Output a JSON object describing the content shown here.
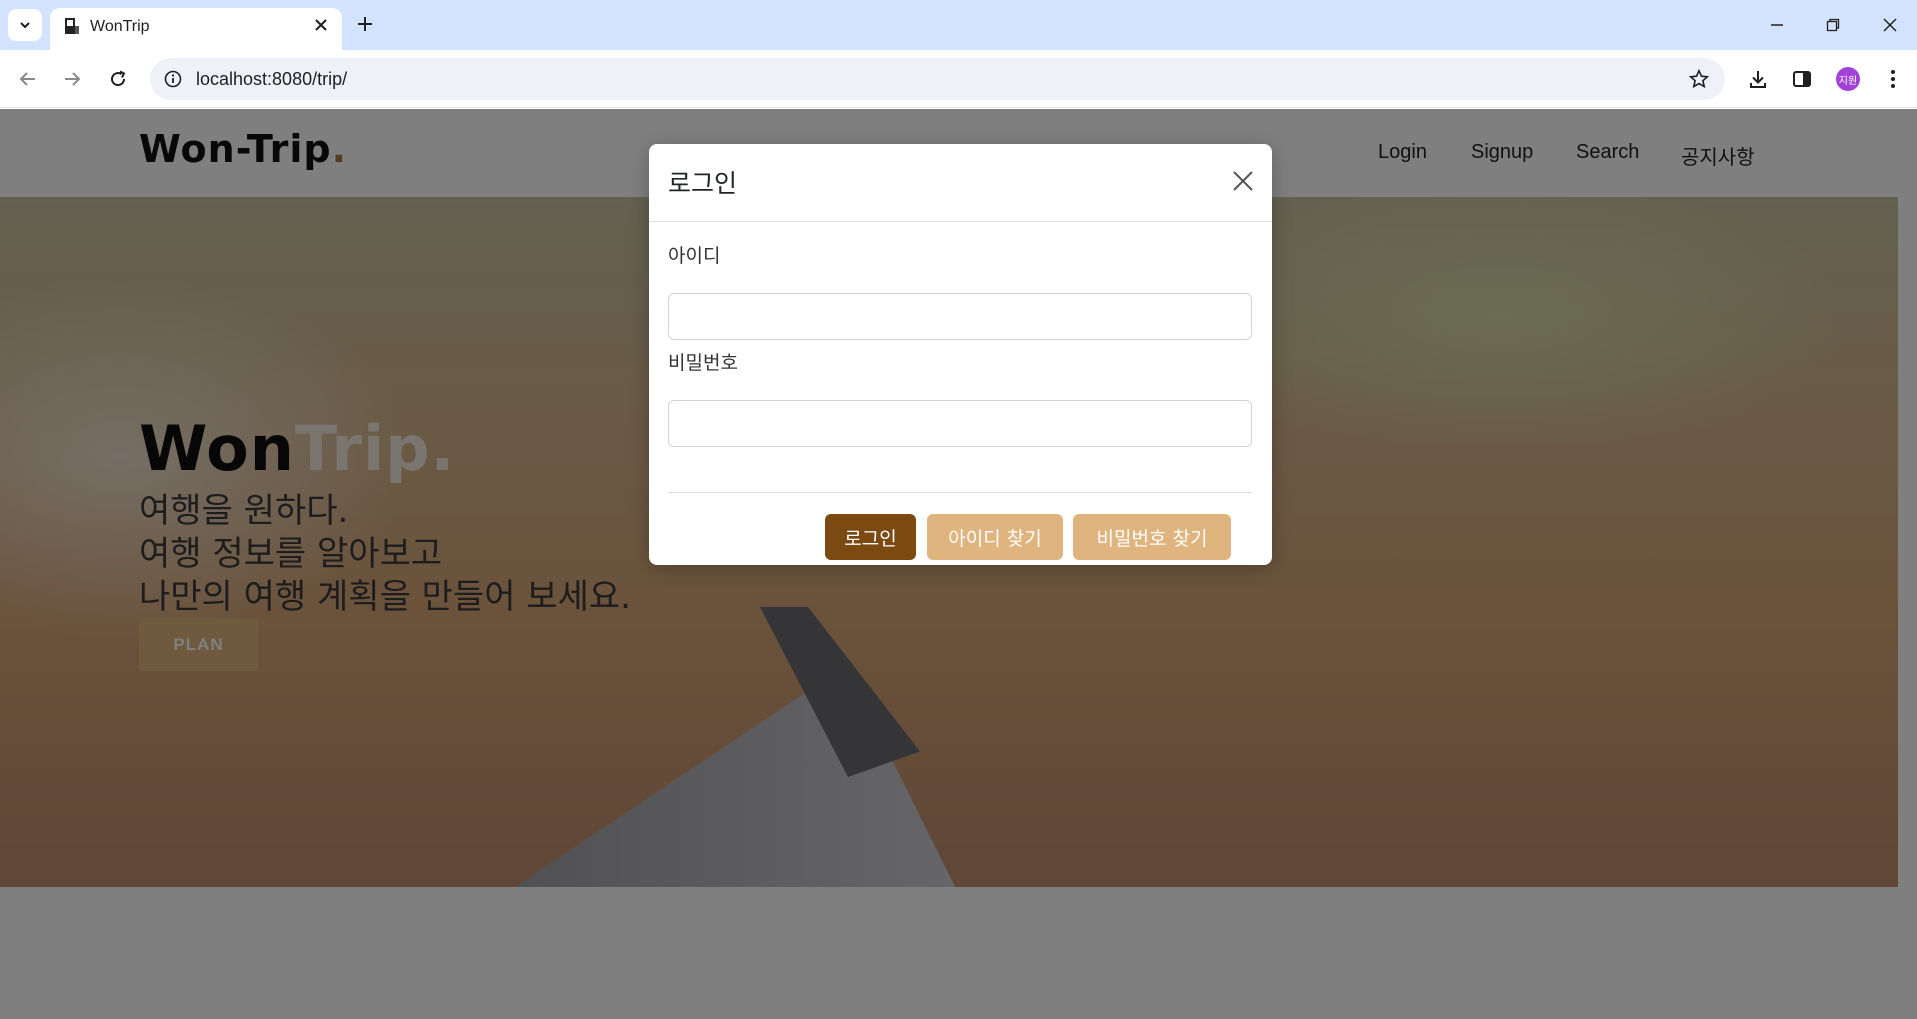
{
  "browser": {
    "tab_title": "WonTrip",
    "url": "localhost:8080/trip/",
    "profile_initials": "지원"
  },
  "site": {
    "brand_main": "Won-Trip",
    "brand_dot": ".",
    "nav": [
      "Login",
      "Signup",
      "Search",
      "공지사항"
    ]
  },
  "hero": {
    "title_won": "Won",
    "title_trip": "Trip.",
    "lines": [
      "여행을 원하다.",
      "여행 정보를 알아보고",
      "나만의 여행 계획을 만들어 보세요."
    ],
    "plan_button": "PLAN"
  },
  "modal": {
    "title": "로그인",
    "id_label": "아이디",
    "id_value": "",
    "password_label": "비밀번호",
    "password_value": "",
    "login_button": "로그인",
    "find_id_button": "아이디 찾기",
    "find_password_button": "비밀번호 찾기"
  },
  "colors": {
    "primary_button": "#7b4a12",
    "secondary_button": "#e0b47e",
    "brand_accent": "#b0793c",
    "profile_avatar": "#a142d6"
  }
}
